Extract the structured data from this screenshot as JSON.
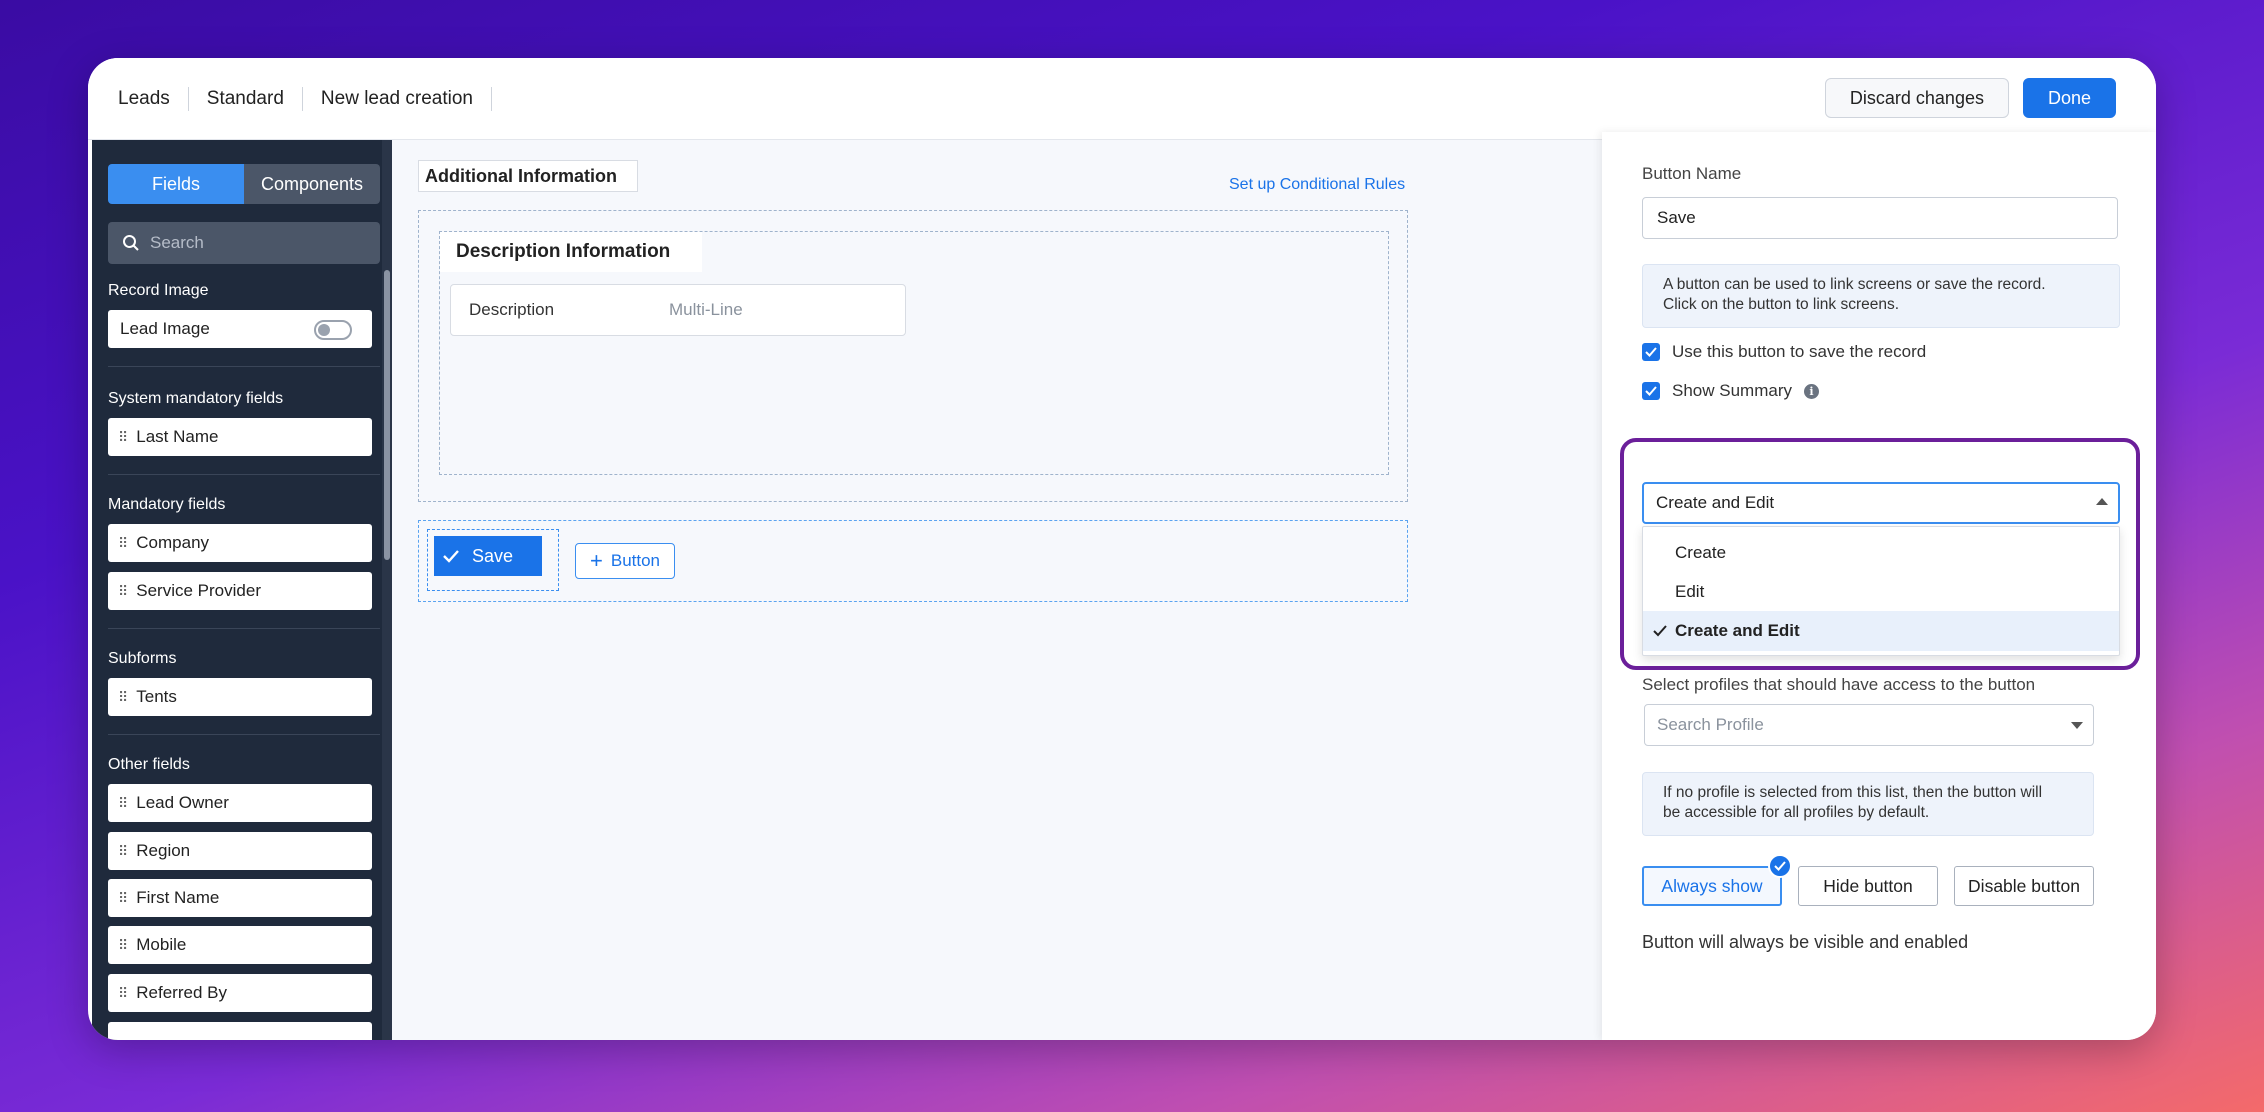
{
  "header": {
    "breadcrumbs": [
      "Leads",
      "Standard",
      "New lead creation"
    ],
    "discard_label": "Discard changes",
    "done_label": "Done"
  },
  "sidebar": {
    "tabs": [
      "Fields",
      "Components"
    ],
    "search_placeholder": "Search",
    "sections": {
      "record_image": "Record Image",
      "system_mandatory": "System mandatory fields",
      "mandatory": "Mandatory fields",
      "subforms": "Subforms",
      "other": "Other fields"
    },
    "lead_image": "Lead Image",
    "system_fields": [
      "Last Name"
    ],
    "mandatory_fields": [
      "Company",
      "Service Provider"
    ],
    "subform_fields": [
      "Tents"
    ],
    "other_fields": [
      "Lead Owner",
      "Region",
      "First Name",
      "Mobile",
      "Referred By"
    ]
  },
  "canvas": {
    "section_tag": "Additional Information",
    "conditional_link": "Set up Conditional Rules",
    "desc_title": "Description Information",
    "desc_field_label": "Description",
    "desc_field_type": "Multi-Line",
    "save_label": "Save",
    "add_button_label": "Button"
  },
  "panel": {
    "button_name_label": "Button Name",
    "button_name_value": "Save",
    "info_text_1": "A button can be used to link screens or save the record.",
    "info_text_2": "Click on the button to link screens.",
    "use_save_label": "Use this button to save the record",
    "show_summary_label": "Show Summary",
    "summary_selected": "Create and Edit",
    "summary_options": [
      "Create",
      "Edit",
      "Create and Edit"
    ],
    "profiles_label": "Select profiles that should have access to the button",
    "profile_placeholder": "Search Profile",
    "profile_info_1": "If no profile is selected from this list, then the button will",
    "profile_info_2": "be accessible for all profiles by default.",
    "visibility": [
      "Always show",
      "Hide button",
      "Disable button"
    ],
    "visibility_note": "Button will always be visible and enabled"
  },
  "colors": {
    "accent": "#1a73e8",
    "sidebar_bg": "#1f2a3c",
    "highlight_border": "#6b1f9a"
  }
}
